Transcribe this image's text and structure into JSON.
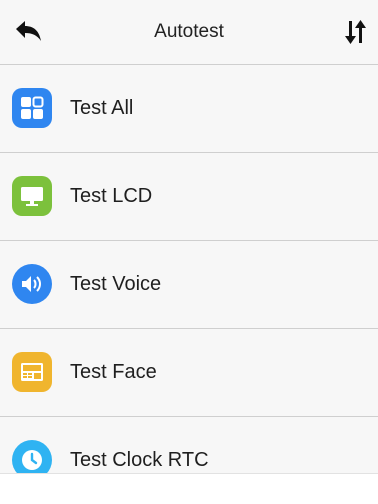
{
  "header": {
    "title": "Autotest",
    "back_icon": "back-arrow-icon",
    "sort_icon": "sort-icon"
  },
  "items": [
    {
      "label": "Test All",
      "icon": "grid-icon",
      "color": "#2f86f0"
    },
    {
      "label": "Test LCD",
      "icon": "monitor-icon",
      "color": "#7cc13c"
    },
    {
      "label": "Test Voice",
      "icon": "speaker-icon",
      "color": "#2f86f0"
    },
    {
      "label": "Test Face",
      "icon": "face-terminal-icon",
      "color": "#f0b52e"
    },
    {
      "label": "Test Clock RTC",
      "icon": "clock-icon",
      "color": "#2fb3f2"
    }
  ]
}
